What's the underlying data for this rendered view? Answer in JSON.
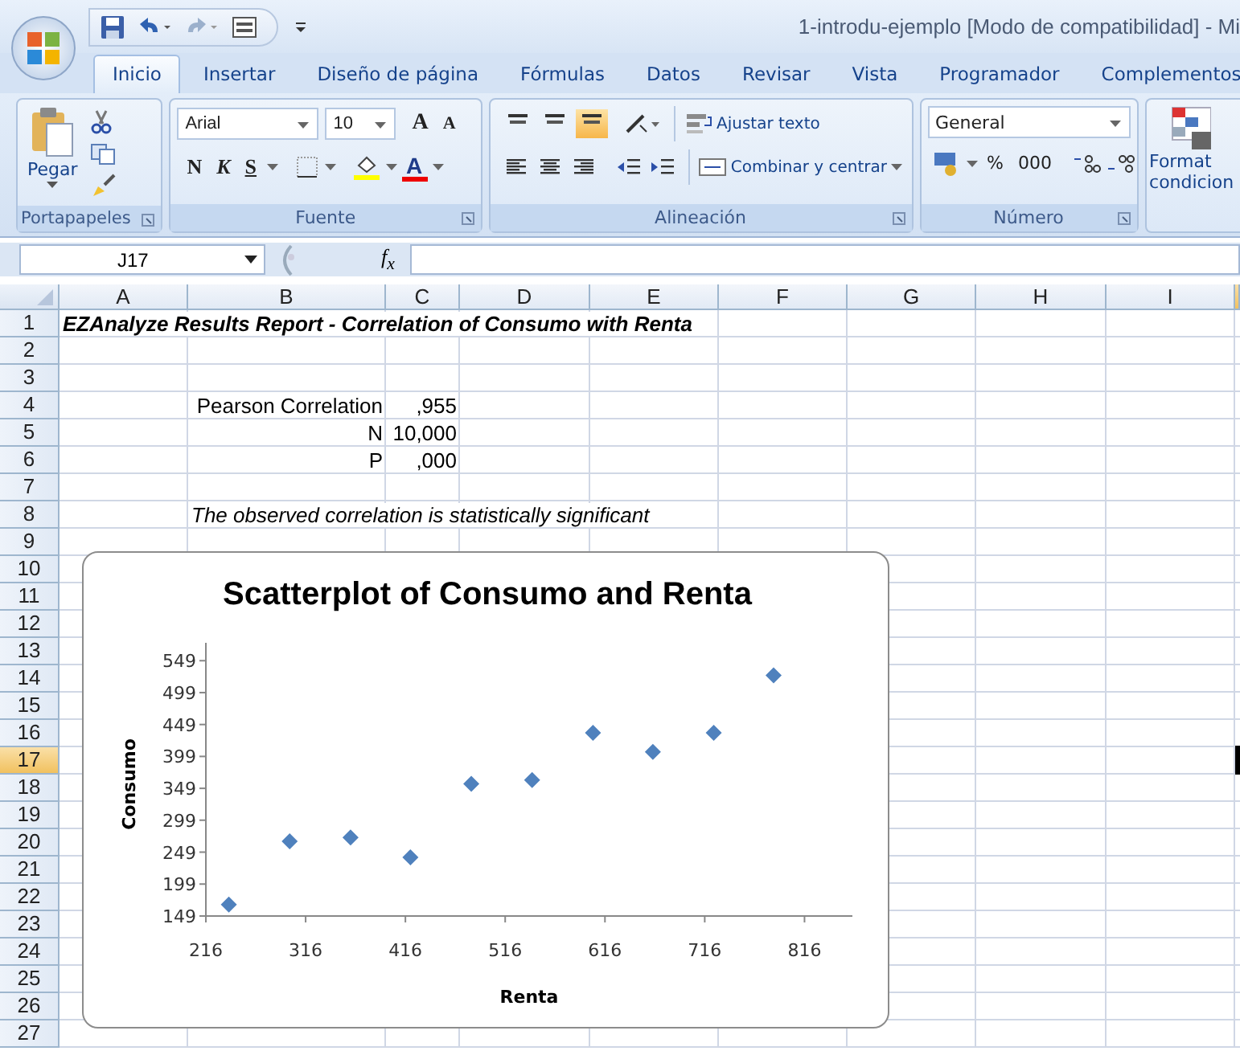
{
  "window": {
    "title": "1-introdu-ejemplo  [Modo de compatibilidad] - Mi"
  },
  "tabs": [
    {
      "label": "Inicio",
      "selected": true
    },
    {
      "label": "Insertar",
      "selected": false
    },
    {
      "label": "Diseño de página",
      "selected": false
    },
    {
      "label": "Fórmulas",
      "selected": false
    },
    {
      "label": "Datos",
      "selected": false
    },
    {
      "label": "Revisar",
      "selected": false
    },
    {
      "label": "Vista",
      "selected": false
    },
    {
      "label": "Programador",
      "selected": false
    },
    {
      "label": "Complementos",
      "selected": false
    }
  ],
  "ribbon": {
    "clipboard": {
      "label": "Portapapeles",
      "paste": "Pegar"
    },
    "font": {
      "label": "Fuente",
      "family": "Arial",
      "size": "10",
      "grow": "A",
      "shrink": "A",
      "bold": "N",
      "italic": "K",
      "underline": "S",
      "font_color": "A"
    },
    "alignment": {
      "label": "Alineación",
      "vertical": [
        {
          "selected": false
        },
        {
          "selected": false
        },
        {
          "selected": true
        }
      ],
      "wrap": "Ajustar texto",
      "merge": "Combinar y centrar"
    },
    "number": {
      "label": "Número",
      "format": "General",
      "percent": "%",
      "thousands": "000"
    },
    "styles": {
      "button_lines": [
        "Format",
        "condicion"
      ]
    }
  },
  "formula_bar": {
    "name_box": "J17",
    "fx": "f$_{x}$"
  },
  "sheet": {
    "columns": [
      {
        "label": "A",
        "selected": false
      },
      {
        "label": "B",
        "selected": false
      },
      {
        "label": "C",
        "selected": false
      },
      {
        "label": "D",
        "selected": false
      },
      {
        "label": "E",
        "selected": false
      },
      {
        "label": "F",
        "selected": false
      },
      {
        "label": "G",
        "selected": false
      },
      {
        "label": "H",
        "selected": false
      },
      {
        "label": "I",
        "selected": false
      }
    ],
    "rows": [
      {
        "number": "1",
        "selected": false,
        "cells": {
          "A": {
            "text": "EZAnalyze Results Report - Correlation of Consumo with Renta",
            "kind": "title"
          }
        }
      },
      {
        "number": "2",
        "selected": false,
        "cells": {}
      },
      {
        "number": "3",
        "selected": false,
        "cells": {}
      },
      {
        "number": "4",
        "selected": false,
        "cells": {
          "B": {
            "text": "Pearson Correlation",
            "kind": "label"
          },
          "C": {
            "text": ",955",
            "kind": "value"
          }
        }
      },
      {
        "number": "5",
        "selected": false,
        "cells": {
          "B": {
            "text": "N",
            "kind": "label"
          },
          "C": {
            "text": "10,000",
            "kind": "value"
          }
        }
      },
      {
        "number": "6",
        "selected": false,
        "cells": {
          "B": {
            "text": "P",
            "kind": "label"
          },
          "C": {
            "text": ",000",
            "kind": "value"
          }
        }
      },
      {
        "number": "7",
        "selected": false,
        "cells": {}
      },
      {
        "number": "8",
        "selected": false,
        "cells": {
          "B": {
            "text": "The observed correlation is statistically significant",
            "kind": "note"
          }
        }
      },
      {
        "number": "9",
        "selected": false,
        "cells": {}
      },
      {
        "number": "10",
        "selected": false,
        "cells": {}
      },
      {
        "number": "11",
        "selected": false,
        "cells": {}
      },
      {
        "number": "12",
        "selected": false,
        "cells": {}
      },
      {
        "number": "13",
        "selected": false,
        "cells": {}
      },
      {
        "number": "14",
        "selected": false,
        "cells": {}
      },
      {
        "number": "15",
        "selected": false,
        "cells": {}
      },
      {
        "number": "16",
        "selected": false,
        "cells": {}
      },
      {
        "number": "17",
        "selected": true,
        "cells": {}
      },
      {
        "number": "18",
        "selected": false,
        "cells": {}
      },
      {
        "number": "19",
        "selected": false,
        "cells": {}
      },
      {
        "number": "20",
        "selected": false,
        "cells": {}
      },
      {
        "number": "21",
        "selected": false,
        "cells": {}
      },
      {
        "number": "22",
        "selected": false,
        "cells": {}
      },
      {
        "number": "23",
        "selected": false,
        "cells": {}
      },
      {
        "number": "24",
        "selected": false,
        "cells": {}
      },
      {
        "number": "25",
        "selected": false,
        "cells": {}
      },
      {
        "number": "26",
        "selected": false,
        "cells": {}
      },
      {
        "number": "27",
        "selected": false,
        "cells": {}
      }
    ],
    "chart_data": {
      "type": "scatter",
      "title": "Scatterplot of Consumo and Renta",
      "xlabel": "Renta",
      "ylabel": "Consumo",
      "x": [
        239,
        300,
        361,
        421,
        482,
        543,
        604,
        664,
        725,
        785
      ],
      "series": [
        {
          "color": "#4f81bd",
          "values": [
            167,
            266,
            272,
            241,
            356,
            362,
            436,
            406,
            436,
            526
          ]
        }
      ],
      "xlim": [
        216,
        864
      ],
      "ylim": [
        149,
        577
      ],
      "xticks": [
        216,
        316,
        416,
        516,
        616,
        716,
        816
      ],
      "yticks": [
        149,
        199,
        249,
        299,
        349,
        399,
        449,
        499,
        549
      ]
    }
  }
}
